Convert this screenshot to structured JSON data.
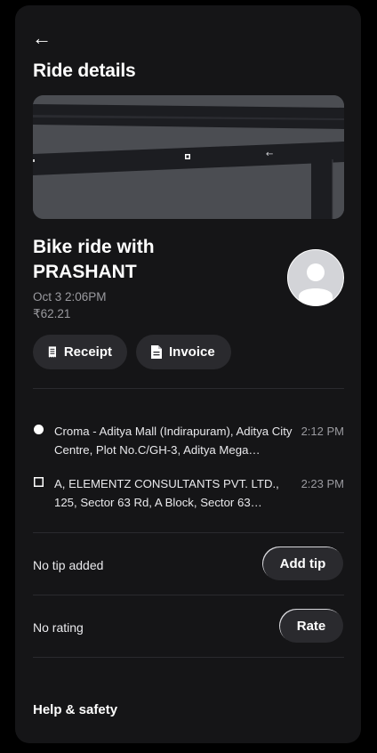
{
  "header": {
    "back_icon": "arrow-left-icon",
    "title": "Ride details"
  },
  "ride": {
    "title": "Bike ride with PRASHANT",
    "time": "Oct 3 2:06PM",
    "fare": "₹62.21",
    "avatar_icon": "person-icon"
  },
  "actions": {
    "receipt_label": "Receipt",
    "receipt_icon": "receipt-icon",
    "invoice_label": "Invoice",
    "invoice_icon": "document-icon"
  },
  "route": {
    "pickup": {
      "address": "Croma - Aditya Mall (Indirapuram), Aditya City Centre, Plot No.C/GH-3, Aditya Mega…",
      "time": "2:12 PM"
    },
    "dropoff": {
      "address": "A, ELEMENTZ CONSULTANTS PVT. LTD., 125, Sector 63 Rd, A Block, Sector 63…",
      "time": "2:23 PM"
    }
  },
  "tip": {
    "status": "No tip added",
    "button_label": "Add tip"
  },
  "rating": {
    "status": "No rating",
    "button_label": "Rate"
  },
  "help": {
    "label": "Help & safety"
  },
  "colors": {
    "background": "#000000",
    "card": "#151517",
    "pill": "#2a2a2e",
    "map": "#4b4d52",
    "muted_text": "#9a9a9f"
  }
}
